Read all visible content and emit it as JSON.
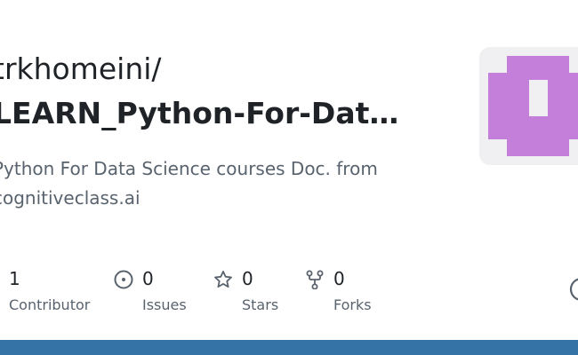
{
  "repo": {
    "owner": "trkhomeini/",
    "name": "LEARN_Python-For-Dat…",
    "description": "Python For Data Science courses Doc. from cognitiveclass.ai"
  },
  "stats": {
    "contributors": {
      "value": "1",
      "label": "Contributor",
      "icon": "people-icon"
    },
    "issues": {
      "value": "0",
      "label": "Issues",
      "icon": "issue-opened-icon"
    },
    "stars": {
      "value": "0",
      "label": "Stars",
      "icon": "star-icon"
    },
    "forks": {
      "value": "0",
      "label": "Forks",
      "icon": "repo-forked-icon"
    }
  },
  "colors": {
    "language_bar": "#3572a5",
    "avatar": "#c47fdb",
    "avatar_bg": "#f0f0f2",
    "muted_text": "#59636e"
  }
}
